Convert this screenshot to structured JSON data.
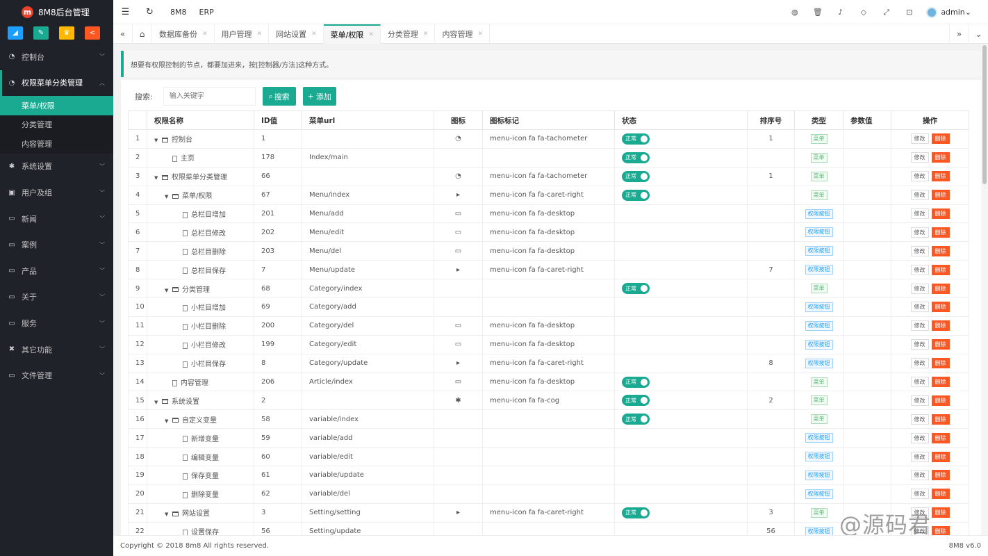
{
  "app": {
    "title": "8M8后台管理",
    "logo_letter": "m"
  },
  "quick_buttons": [
    {
      "icon": "chart-icon",
      "glyph": "◢",
      "color": "#1e9fff"
    },
    {
      "icon": "pencil-icon",
      "glyph": "✎",
      "color": "#1aaa92"
    },
    {
      "icon": "user-icon",
      "glyph": "♛",
      "color": "#ffb800"
    },
    {
      "icon": "share-icon",
      "glyph": "<",
      "color": "#ff5722"
    }
  ],
  "sidebar": {
    "items": [
      {
        "label": "控制台",
        "icon": "dashboard-icon",
        "glyph": "◔"
      },
      {
        "label": "权限菜单分类管理",
        "icon": "dashboard-icon",
        "glyph": "◔"
      },
      {
        "label": "系统设置",
        "icon": "gear-icon",
        "glyph": "✱"
      },
      {
        "label": "用户及组",
        "icon": "users-icon",
        "glyph": "▣"
      },
      {
        "label": "新闻",
        "icon": "desktop-icon",
        "glyph": "▭"
      },
      {
        "label": "案例",
        "icon": "desktop-icon",
        "glyph": "▭"
      },
      {
        "label": "产品",
        "icon": "desktop-icon",
        "glyph": "▭"
      },
      {
        "label": "关于",
        "icon": "desktop-icon",
        "glyph": "▭"
      },
      {
        "label": "服务",
        "icon": "desktop-icon",
        "glyph": "▭"
      },
      {
        "label": "其它功能",
        "icon": "wrench-icon",
        "glyph": "✖"
      },
      {
        "label": "文件管理",
        "icon": "desktop-icon",
        "glyph": "▭"
      }
    ],
    "sub_items": [
      "菜单/权限",
      "分类管理",
      "内容管理"
    ]
  },
  "header": {
    "menu_icon": "☰",
    "refresh_icon": "↻",
    "tabs": [
      "8M8",
      "ERP"
    ],
    "right_icons": [
      {
        "name": "globe-icon",
        "glyph": "◍"
      },
      {
        "name": "trash-icon",
        "glyph": "🗑"
      },
      {
        "name": "bell-icon",
        "glyph": "♪"
      },
      {
        "name": "tag-icon",
        "glyph": "◇"
      },
      {
        "name": "fullscreen-icon",
        "glyph": "⤢"
      },
      {
        "name": "lock-icon",
        "glyph": "⊡"
      }
    ],
    "user": "admin"
  },
  "page_tabs": {
    "home_icon": "⌂",
    "items": [
      "数据库备份",
      "用户管理",
      "网站设置",
      "菜单/权限",
      "分类管理",
      "内容管理"
    ],
    "active_index": 3
  },
  "tip": "想要有权限控制的节点，都要加进来，按[控制器/方法]这种方式。",
  "search": {
    "label": "搜索:",
    "placeholder": "输入关键字",
    "search_btn": "搜索",
    "add_btn": "添加"
  },
  "table": {
    "columns": [
      "",
      "权限名称",
      "ID值",
      "菜单url",
      "图标",
      "图标标记",
      "状态",
      "排序号",
      "类型",
      "参数值",
      "操作"
    ],
    "toggle_label": "正常",
    "type_labels": {
      "menu": "菜单",
      "perm": "权限按钮"
    },
    "action_labels": {
      "edit": "修改",
      "del": "删除"
    },
    "rows": [
      {
        "n": "1",
        "level": 0,
        "kind": "folder",
        "name": "控制台",
        "id": "1",
        "url": "",
        "icon": "◔",
        "icon_class": "menu-icon fa fa-tachometer",
        "status": true,
        "sort": "1",
        "type": "menu"
      },
      {
        "n": "2",
        "level": 1,
        "kind": "file",
        "name": "主页",
        "id": "178",
        "url": "Index/main",
        "icon": "",
        "icon_class": "",
        "status": true,
        "sort": "",
        "type": "menu"
      },
      {
        "n": "3",
        "level": 0,
        "kind": "folder",
        "name": "权限菜单分类管理",
        "id": "66",
        "url": "",
        "icon": "◔",
        "icon_class": "menu-icon fa fa-tachometer",
        "status": true,
        "sort": "1",
        "type": "menu"
      },
      {
        "n": "4",
        "level": 1,
        "kind": "folder",
        "name": "菜单/权限",
        "id": "67",
        "url": "Menu/index",
        "icon": "▸",
        "icon_class": "menu-icon fa fa-caret-right",
        "status": true,
        "sort": "",
        "type": "menu"
      },
      {
        "n": "5",
        "level": 2,
        "kind": "file",
        "name": "总栏目增加",
        "id": "201",
        "url": "Menu/add",
        "icon": "▭",
        "icon_class": "menu-icon fa fa-desktop",
        "status": false,
        "sort": "",
        "type": "perm"
      },
      {
        "n": "6",
        "level": 2,
        "kind": "file",
        "name": "总栏目修改",
        "id": "202",
        "url": "Menu/edit",
        "icon": "▭",
        "icon_class": "menu-icon fa fa-desktop",
        "status": false,
        "sort": "",
        "type": "perm"
      },
      {
        "n": "7",
        "level": 2,
        "kind": "file",
        "name": "总栏目删除",
        "id": "203",
        "url": "Menu/del",
        "icon": "▭",
        "icon_class": "menu-icon fa fa-desktop",
        "status": false,
        "sort": "",
        "type": "perm"
      },
      {
        "n": "8",
        "level": 2,
        "kind": "file",
        "name": "总栏目保存",
        "id": "7",
        "url": "Menu/update",
        "icon": "▸",
        "icon_class": "menu-icon fa fa-caret-right",
        "status": false,
        "sort": "7",
        "type": "perm"
      },
      {
        "n": "9",
        "level": 1,
        "kind": "folder",
        "name": "分类管理",
        "id": "68",
        "url": "Category/index",
        "icon": "",
        "icon_class": "",
        "status": true,
        "sort": "",
        "type": "menu"
      },
      {
        "n": "10",
        "level": 2,
        "kind": "file",
        "name": "小栏目增加",
        "id": "69",
        "url": "Category/add",
        "icon": "",
        "icon_class": "",
        "status": false,
        "sort": "",
        "type": "perm"
      },
      {
        "n": "11",
        "level": 2,
        "kind": "file",
        "name": "小栏目删除",
        "id": "200",
        "url": "Category/del",
        "icon": "▭",
        "icon_class": "menu-icon fa fa-desktop",
        "status": false,
        "sort": "",
        "type": "perm"
      },
      {
        "n": "12",
        "level": 2,
        "kind": "file",
        "name": "小栏目修改",
        "id": "199",
        "url": "Category/edit",
        "icon": "▭",
        "icon_class": "menu-icon fa fa-desktop",
        "status": false,
        "sort": "",
        "type": "perm"
      },
      {
        "n": "13",
        "level": 2,
        "kind": "file",
        "name": "小栏目保存",
        "id": "8",
        "url": "Category/update",
        "icon": "▸",
        "icon_class": "menu-icon fa fa-caret-right",
        "status": false,
        "sort": "8",
        "type": "perm"
      },
      {
        "n": "14",
        "level": 1,
        "kind": "file",
        "name": "内容管理",
        "id": "206",
        "url": "Article/index",
        "icon": "▭",
        "icon_class": "menu-icon fa fa-desktop",
        "status": true,
        "sort": "",
        "type": "menu"
      },
      {
        "n": "15",
        "level": 0,
        "kind": "folder",
        "name": "系统设置",
        "id": "2",
        "url": "",
        "icon": "✱",
        "icon_class": "menu-icon fa fa-cog",
        "status": true,
        "sort": "2",
        "type": "menu"
      },
      {
        "n": "16",
        "level": 1,
        "kind": "folder",
        "name": "自定义变量",
        "id": "58",
        "url": "variable/index",
        "icon": "",
        "icon_class": "",
        "status": true,
        "sort": "",
        "type": "menu"
      },
      {
        "n": "17",
        "level": 2,
        "kind": "file",
        "name": "新增变量",
        "id": "59",
        "url": "variable/add",
        "icon": "",
        "icon_class": "",
        "status": false,
        "sort": "",
        "type": "perm"
      },
      {
        "n": "18",
        "level": 2,
        "kind": "file",
        "name": "编辑变量",
        "id": "60",
        "url": "variable/edit",
        "icon": "",
        "icon_class": "",
        "status": false,
        "sort": "",
        "type": "perm"
      },
      {
        "n": "19",
        "level": 2,
        "kind": "file",
        "name": "保存变量",
        "id": "61",
        "url": "variable/update",
        "icon": "",
        "icon_class": "",
        "status": false,
        "sort": "",
        "type": "perm"
      },
      {
        "n": "20",
        "level": 2,
        "kind": "file",
        "name": "删除变量",
        "id": "62",
        "url": "variable/del",
        "icon": "",
        "icon_class": "",
        "status": false,
        "sort": "",
        "type": "perm"
      },
      {
        "n": "21",
        "level": 1,
        "kind": "folder",
        "name": "网站设置",
        "id": "3",
        "url": "Setting/setting",
        "icon": "▸",
        "icon_class": "menu-icon fa fa-caret-right",
        "status": true,
        "sort": "3",
        "type": "menu"
      },
      {
        "n": "22",
        "level": 2,
        "kind": "file",
        "name": "设置保存",
        "id": "56",
        "url": "Setting/update",
        "icon": "",
        "icon_class": "",
        "status": false,
        "sort": "56",
        "type": "perm"
      }
    ]
  },
  "footer": {
    "copyright": "Copyright © 2018 8m8 All rights reserved.",
    "version": "8M8 v6.0"
  },
  "watermark": "@源码君"
}
